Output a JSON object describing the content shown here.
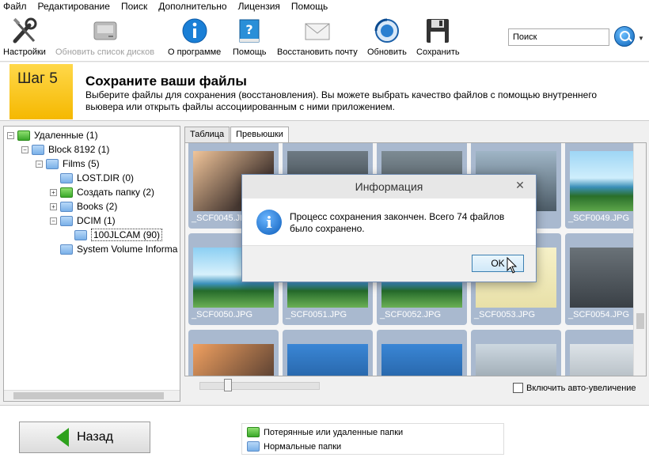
{
  "menu": [
    "Файл",
    "Редактирование",
    "Поиск",
    "Дополнительно",
    "Лицензия",
    "Помощь"
  ],
  "toolbar": {
    "settings": "Настройки",
    "refresh_disks": "Обновить список дисков",
    "about": "О программе",
    "help": "Помощь",
    "restore_mail": "Восстановить почту",
    "update": "Обновить",
    "save": "Сохранить",
    "search_value": "Поиск"
  },
  "step": {
    "badge": "Шаг 5",
    "title": "Сохраните ваши файлы",
    "description": "Выберите файлы для сохранения (восстановления). Вы можете выбрать качество файлов с помощью внутреннего вьювера или открыть файлы ассоциированным с ними приложением."
  },
  "tree": [
    {
      "label": "Удаленные (1)",
      "type": "green",
      "level": 0,
      "expander": "−"
    },
    {
      "label": "Block 8192 (1)",
      "type": "blue",
      "level": 1,
      "expander": "−"
    },
    {
      "label": "Films (5)",
      "type": "blue",
      "level": 2,
      "expander": "−"
    },
    {
      "label": "LOST.DIR (0)",
      "type": "blue",
      "level": 3,
      "expander": ""
    },
    {
      "label": "Создать папку (2)",
      "type": "green",
      "level": 3,
      "expander": "+"
    },
    {
      "label": "Books (2)",
      "type": "blue",
      "level": 3,
      "expander": "+"
    },
    {
      "label": "DCIM (1)",
      "type": "blue",
      "level": 3,
      "expander": "−"
    },
    {
      "label": "100JLCAM (90)",
      "type": "blue",
      "level": 4,
      "expander": "",
      "selected": true
    },
    {
      "label": "System Volume Informa",
      "type": "blue",
      "level": 3,
      "expander": ""
    }
  ],
  "tabs": [
    "Таблица",
    "Превьюшки"
  ],
  "thumbnails": [
    {
      "label": "_SCF0045.JPG"
    },
    {
      "label": ""
    },
    {
      "label": ""
    },
    {
      "label": ""
    },
    {
      "label": "_SCF0049.JPG"
    },
    {
      "label": "_SCF0050.JPG"
    },
    {
      "label": "_SCF0051.JPG"
    },
    {
      "label": "_SCF0052.JPG"
    },
    {
      "label": "_SCF0053.JPG"
    },
    {
      "label": "_SCF0054.JPG"
    },
    {
      "label": ""
    },
    {
      "label": ""
    },
    {
      "label": ""
    },
    {
      "label": ""
    },
    {
      "label": ""
    }
  ],
  "auto_zoom": "Включить авто-увеличение",
  "dialog": {
    "title": "Информация",
    "close": "✕",
    "icon": "i",
    "message": "Процесс сохранения закончен. Всего  74 файлов было сохранено.",
    "ok": "OK"
  },
  "bottom": {
    "back": "Назад",
    "legend_lost": "Потерянные или удаленные папки",
    "legend_normal": "Нормальные папки"
  },
  "colors": {
    "accent_yellow": "#f5b800",
    "thumb_bg": "#a9b9cf",
    "folder_green": "#3aa82a",
    "folder_blue": "#7ab0e8"
  }
}
